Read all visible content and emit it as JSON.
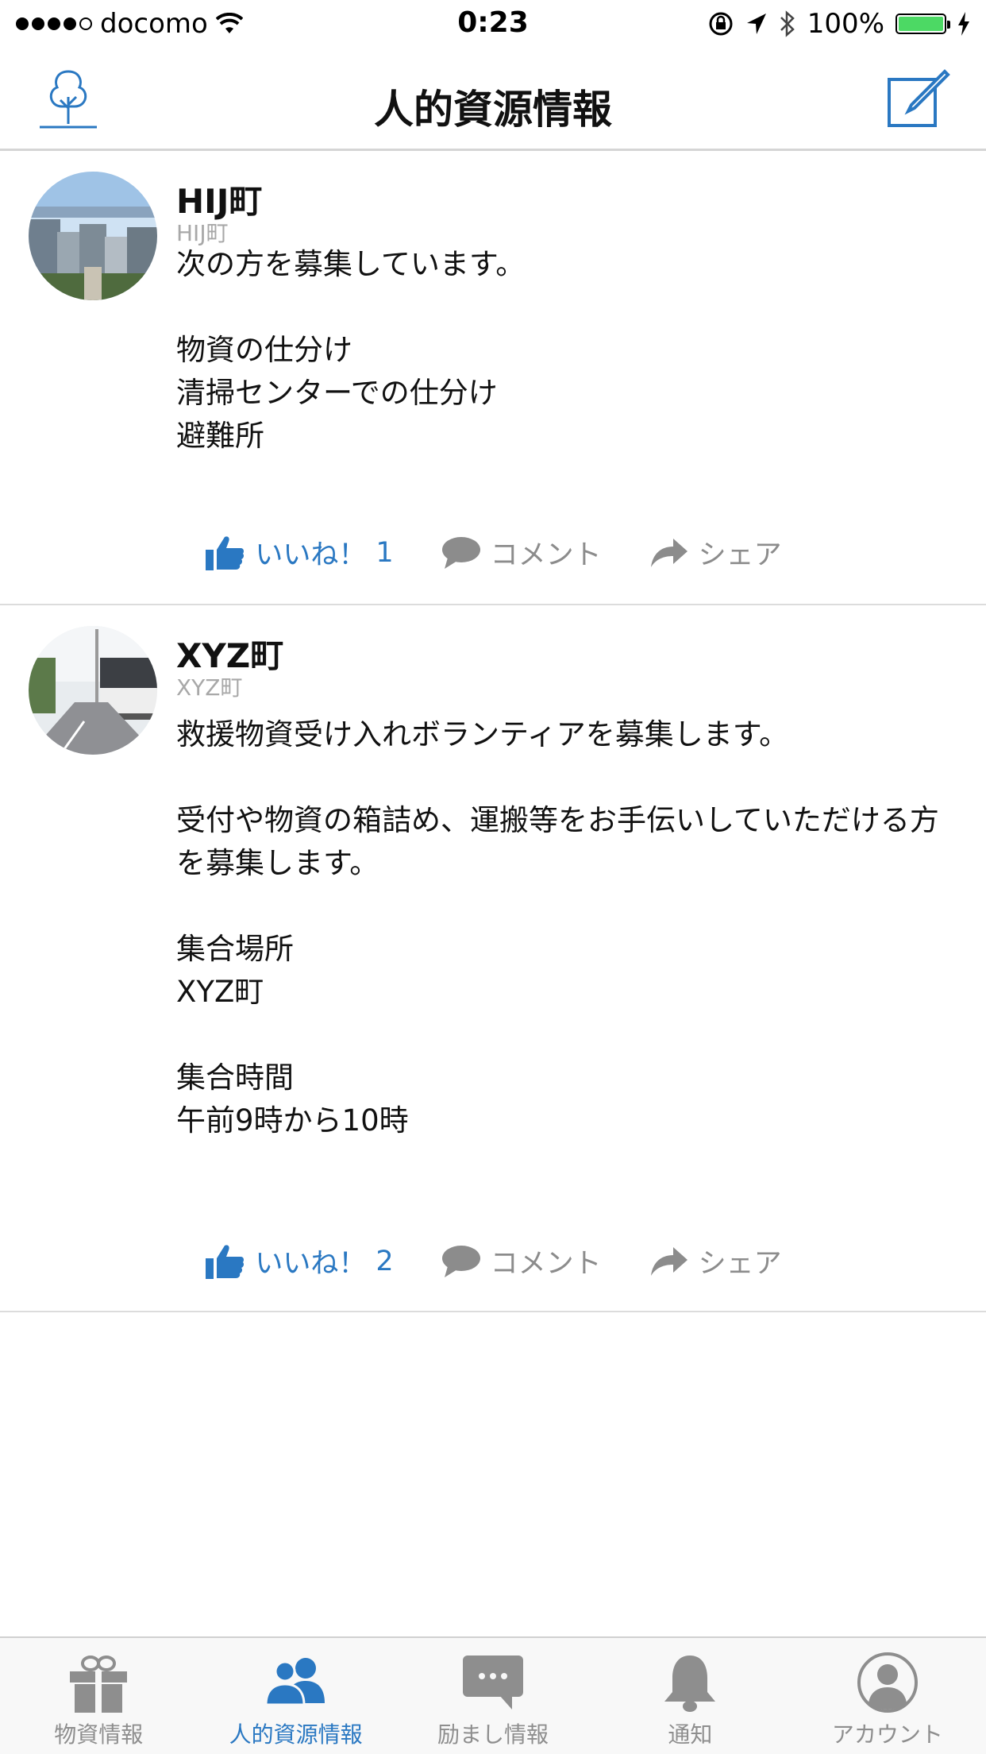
{
  "status_bar": {
    "carrier": "docomo",
    "time": "0:23",
    "battery": "100%",
    "battery_level": 1.0,
    "icons": [
      "signal-dots",
      "wifi-icon",
      "orientation-lock-icon",
      "location-arrow-icon",
      "bluetooth-icon",
      "battery-icon",
      "charging-icon"
    ]
  },
  "nav": {
    "title": "人的資源情報",
    "left_icon": "tree-icon",
    "right_icon": "compose-icon"
  },
  "posts": [
    {
      "name": "HIJ町",
      "handle": "HIJ町",
      "body": "次の方を募集しています。\n\n物資の仕分け\n清掃センターでの仕分け\n避難所",
      "like_label": "いいね！",
      "like_count": "1",
      "comment_label": "コメント",
      "share_label": "シェア"
    },
    {
      "name": "XYZ町",
      "handle": "XYZ町",
      "body": "救援物資受け入れボランティアを募集します。\n\n受付や物資の箱詰め、運搬等をお手伝いしていただける方を募集します。\n\n集合場所\nXYZ町\n\n集合時間\n午前9時から10時",
      "like_label": "いいね！",
      "like_count": "2",
      "comment_label": "コメント",
      "share_label": "シェア"
    }
  ],
  "tabs": [
    {
      "label": "物資情報",
      "icon": "gift-icon",
      "active": false
    },
    {
      "label": "人的資源情報",
      "icon": "people-icon",
      "active": true
    },
    {
      "label": "励まし情報",
      "icon": "chat-bubble-icon",
      "active": false
    },
    {
      "label": "通知",
      "icon": "bell-icon",
      "active": false
    },
    {
      "label": "アカウント",
      "icon": "account-icon",
      "active": false
    }
  ],
  "colors": {
    "accent": "#2a78c2",
    "inactive": "#8e8e8e",
    "battery": "#4cd964"
  }
}
